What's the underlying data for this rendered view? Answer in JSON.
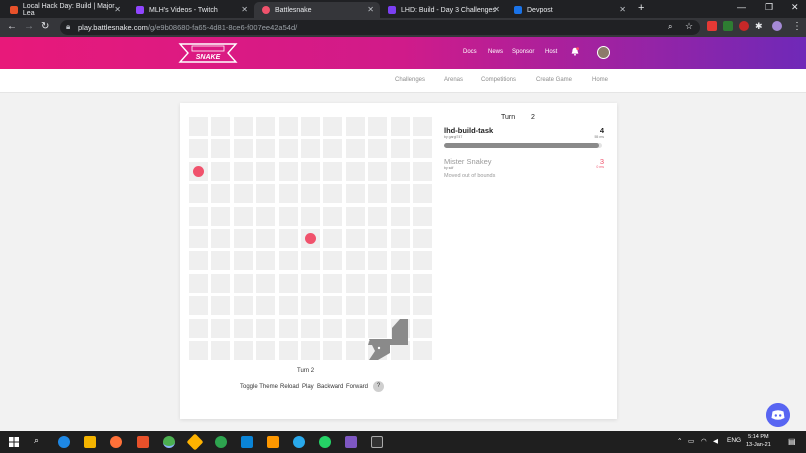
{
  "browser": {
    "tabs": [
      {
        "title": "Local Hack Day: Build | Major Lea",
        "color": "#e8512a"
      },
      {
        "title": "MLH's Videos - Twitch",
        "color": "#9146ff"
      },
      {
        "title": "Battlesnake",
        "color": "#f0526c"
      },
      {
        "title": "LHD: Build - Day 3 Challenges",
        "color": "#7b3ff2"
      },
      {
        "title": "Devpost",
        "color": "#1a73e8"
      }
    ],
    "new_tab": "+",
    "minimize": "—",
    "maximize": "❐",
    "close": "✕",
    "url_host": "play.battlesnake.com",
    "url_path": "/g/e9b08680-fa65-4d81-8ce6-f007ee42a54d/"
  },
  "site": {
    "logo_text": "SNAKE",
    "nav": [
      "Docs",
      "News",
      "Sponsor",
      "Host"
    ],
    "notification_count": "",
    "subnav": [
      "Challenges",
      "Arenas",
      "Competitions",
      "Create Game",
      "Home"
    ]
  },
  "game": {
    "turn_label": "Turn",
    "turn_value": "2",
    "board_size": 11,
    "food": [
      {
        "col": 0,
        "row": 2
      },
      {
        "col": 5,
        "row": 5
      }
    ],
    "snakes": [
      {
        "name": "lhd-build-task",
        "author": "by gargi747",
        "length": "4",
        "latency": "55 ms",
        "health": 0.98,
        "color": "#333333",
        "eliminated": false
      },
      {
        "name": "Mister Snakey",
        "author": "by sdf",
        "length": "3",
        "latency": "0 ms",
        "health": 0,
        "color": "#999999",
        "eliminated": true,
        "elimination_text": "Moved out of bounds"
      }
    ],
    "turn_footer": "Turn 2",
    "controls": [
      "Toggle Theme",
      "Reload",
      "Play",
      "Backward",
      "Forward"
    ],
    "help": "?"
  },
  "taskbar": {
    "language": "ENG",
    "time": "5:14 PM",
    "date": "13-Jan-21"
  },
  "colors": {
    "header_start": "#e8197a",
    "header_end": "#6f29b8",
    "food": "#f0526c",
    "snake": "#8a8a8a",
    "discord": "#5865f2"
  }
}
